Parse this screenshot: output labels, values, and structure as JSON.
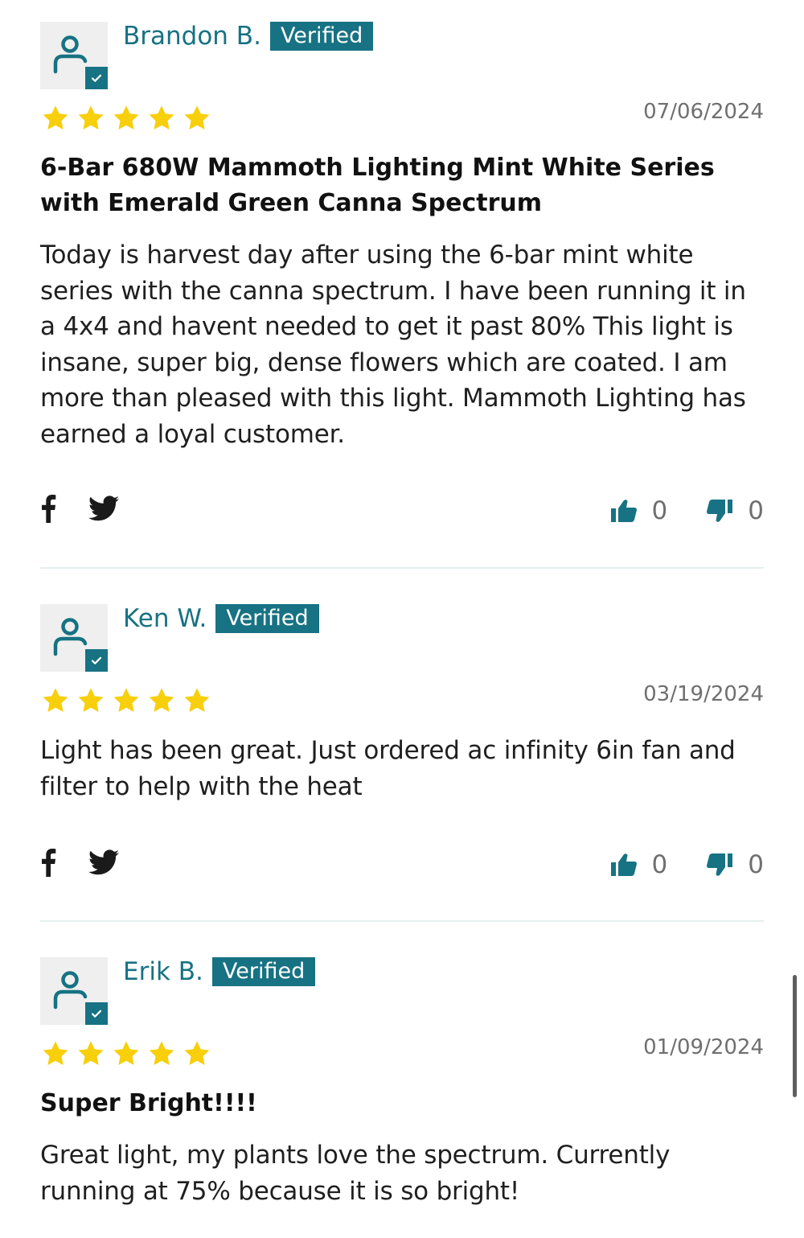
{
  "colors": {
    "accent": "#177283",
    "star": "#f7cf0b",
    "text": "#1f1f1f",
    "muted": "#6f6f6f",
    "divider": "#e6eeef",
    "avatar_bg": "#efefef"
  },
  "reviews": [
    {
      "author": "Brandon B.",
      "badge": "Verified",
      "rating": 5,
      "date": "07/06/2024",
      "title": "6-Bar 680W Mammoth Lighting Mint White Series with Emerald Green Canna Spectrum",
      "body": "Today is harvest day after using the 6-bar mint white series with the canna spectrum. I have been running it in a 4x4 and havent needed to get it past 80% This light is insane, super big, dense flowers which are coated. I am more than pleased with this light. Mammoth Lighting has earned a loyal customer.",
      "thumbs_up": "0",
      "thumbs_down": "0"
    },
    {
      "author": "Ken W.",
      "badge": "Verified",
      "rating": 5,
      "date": "03/19/2024",
      "title": "",
      "body": "Light has been great. Just ordered ac infinity 6in fan and filter to help with the heat",
      "thumbs_up": "0",
      "thumbs_down": "0"
    },
    {
      "author": "Erik B.",
      "badge": "Verified",
      "rating": 5,
      "date": "01/09/2024",
      "title": "Super Bright!!!!",
      "body": "Great light, my plants love the spectrum. Currently running at 75% because it is so bright!"
    }
  ],
  "icons": {
    "avatar": "user-icon",
    "verified_check": "check-icon",
    "star": "star-icon",
    "share_facebook": "facebook-icon",
    "share_twitter": "twitter-icon",
    "vote_up": "thumbs-up-icon",
    "vote_down": "thumbs-down-icon"
  }
}
